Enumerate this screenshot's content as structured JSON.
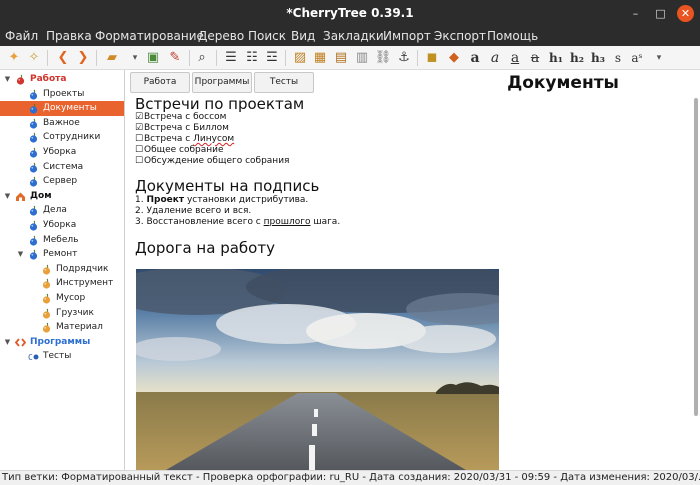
{
  "window": {
    "title": "*CherryTree 0.39.1",
    "minimize_glyph": "–",
    "maximize_glyph": "□",
    "close_glyph": "✕",
    "close_color": "#e95420"
  },
  "menu": [
    "Файл",
    "Правка",
    "Форматирование",
    "Дерево",
    "Поиск",
    "Вид",
    "Закладки",
    "Импорт",
    "Экспорт",
    "Помощь"
  ],
  "toolbar": {
    "icons": [
      {
        "name": "add-node-icon",
        "glyph": "✦"
      },
      {
        "name": "add-subnode-icon",
        "glyph": "✧"
      },
      {
        "name": "go-back-icon",
        "glyph": "❮"
      },
      {
        "name": "go-forward-icon",
        "glyph": "❯"
      },
      {
        "name": "open-folder-icon",
        "glyph": "▰"
      },
      {
        "name": "save-icon",
        "glyph": "▣"
      },
      {
        "name": "export-icon",
        "glyph": "✎"
      },
      {
        "name": "search-icon",
        "glyph": "⌕"
      },
      {
        "name": "bulleted-list-icon",
        "glyph": "☰"
      },
      {
        "name": "numbered-list-icon",
        "glyph": "☷"
      },
      {
        "name": "todo-list-icon",
        "glyph": "☲"
      },
      {
        "name": "insert-image-icon",
        "glyph": "▨"
      },
      {
        "name": "insert-table-icon",
        "glyph": "▦"
      },
      {
        "name": "insert-codebox-icon",
        "glyph": "▤"
      },
      {
        "name": "insert-file-icon",
        "glyph": "▥"
      },
      {
        "name": "insert-link-icon",
        "glyph": "⛓"
      },
      {
        "name": "anchor-icon",
        "glyph": "⚓"
      },
      {
        "name": "text-color-icon",
        "glyph": "◼"
      },
      {
        "name": "highlight-color-icon",
        "glyph": "◆"
      }
    ],
    "format_labels": [
      "a",
      "a",
      "a",
      "a",
      "h₁",
      "h₂",
      "h₃",
      "s",
      "aˢ"
    ],
    "overflow_glyph": "▾"
  },
  "tree": {
    "nodes": [
      {
        "label": "Работа",
        "level": 0,
        "expanded": true,
        "icon": "cherry-icon",
        "color": "#d0342c",
        "top": true,
        "label_color": "#d0342c"
      },
      {
        "label": "Проекты",
        "level": 1,
        "icon": "blue-cherry-icon",
        "color": "#2d6fd0"
      },
      {
        "label": "Документы",
        "level": 1,
        "icon": "blue-cherry-icon",
        "color": "#2d6fd0",
        "selected": true
      },
      {
        "label": "Важное",
        "level": 1,
        "icon": "blue-cherry-icon",
        "color": "#2d6fd0"
      },
      {
        "label": "Сотрудники",
        "level": 1,
        "icon": "blue-cherry-icon",
        "color": "#2d6fd0"
      },
      {
        "label": "Уборка",
        "level": 1,
        "icon": "blue-cherry-icon",
        "color": "#2d6fd0"
      },
      {
        "label": "Система",
        "level": 1,
        "icon": "blue-cherry-icon",
        "color": "#2d6fd0"
      },
      {
        "label": "Сервер",
        "level": 1,
        "icon": "blue-cherry-icon",
        "color": "#2d6fd0"
      },
      {
        "label": "Дом",
        "level": 0,
        "expanded": true,
        "icon": "home-icon",
        "color": "#e06c2a",
        "top": true,
        "label_color": "#111111"
      },
      {
        "label": "Дела",
        "level": 1,
        "icon": "blue-cherry-icon",
        "color": "#2d6fd0"
      },
      {
        "label": "Уборка",
        "level": 1,
        "icon": "blue-cherry-icon",
        "color": "#2d6fd0"
      },
      {
        "label": "Мебель",
        "level": 1,
        "icon": "blue-cherry-icon",
        "color": "#2d6fd0"
      },
      {
        "label": "Ремонт",
        "level": 1,
        "expanded": true,
        "icon": "blue-cherry-icon",
        "color": "#2d6fd0"
      },
      {
        "label": "Подрядчик",
        "level": 2,
        "icon": "orange-cherry-icon",
        "color": "#e8a03a"
      },
      {
        "label": "Инструмент",
        "level": 2,
        "icon": "orange-cherry-icon",
        "color": "#e8a03a"
      },
      {
        "label": "Мусор",
        "level": 2,
        "icon": "orange-cherry-icon",
        "color": "#e8a03a"
      },
      {
        "label": "Грузчик",
        "level": 2,
        "icon": "orange-cherry-icon",
        "color": "#e8a03a"
      },
      {
        "label": "Материал",
        "level": 2,
        "icon": "orange-cherry-icon",
        "color": "#e8a03a"
      },
      {
        "label": "Программы",
        "level": 0,
        "expanded": true,
        "icon": "code-icon",
        "color": "#e05a2a",
        "top": true,
        "label_color": "#2d6fd0"
      },
      {
        "label": "Тесты",
        "level": 1,
        "icon": "code-cherry-icon",
        "color": "#2d5fb0"
      }
    ]
  },
  "tabs": [
    "Работа",
    "Программы",
    "Тесты"
  ],
  "document": {
    "title": "Документы",
    "section1": {
      "heading": "Встречи по проектам",
      "items": [
        {
          "box": "☑",
          "pre": "Встреча с боссом",
          "special": ""
        },
        {
          "box": "☑",
          "pre": "Встреча с Биллом",
          "special": ""
        },
        {
          "box": "☐",
          "pre": "Встреча с ",
          "special": "Линусом"
        },
        {
          "box": "☐",
          "pre": "Общее собрание",
          "special": ""
        },
        {
          "box": "☐",
          "pre": "Обсуждение общего собрания",
          "special": ""
        }
      ]
    },
    "section2": {
      "heading": "Документы на подпись",
      "item1": {
        "num": "1.",
        "bold": "Проект",
        "rest": "установки дистрибутива."
      },
      "item2": {
        "num": "2.",
        "text": "Удаление всего и вся."
      },
      "item3": {
        "num": "3.",
        "pre": "Восстановление всего с ",
        "underlined": "прошлого",
        "post": " шага."
      }
    },
    "section3": {
      "heading": "Дорога на работу"
    }
  },
  "status": {
    "text": "Тип ветки: Форматированный текст  - Проверка орфографии: ru_RU  - Дата создания: 2020/03/31 - 09:59  - Дата изменения: 2020/03/..."
  },
  "colors": {
    "selection": "#e9632e",
    "accent_red": "#d0342c",
    "accent_blue": "#2d6fd0",
    "titlebar": "#2c2c2c",
    "spell_error": "#d92323"
  }
}
